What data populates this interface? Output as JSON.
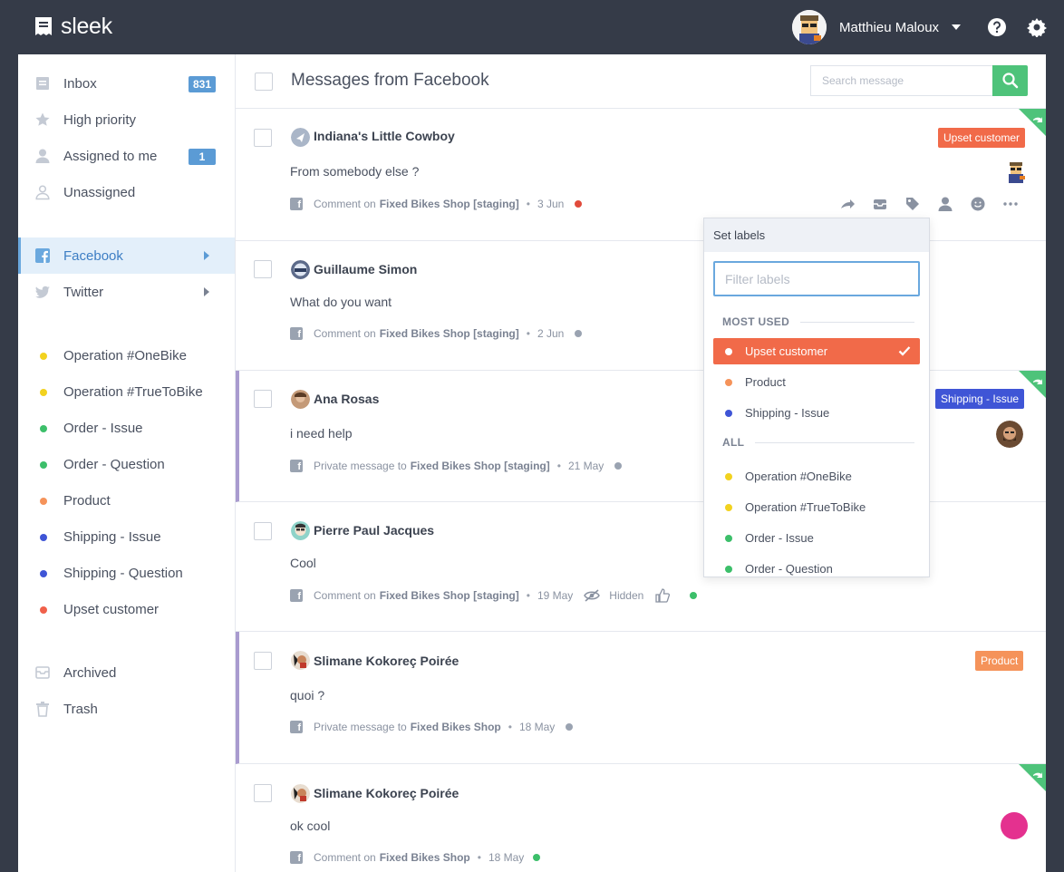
{
  "topbar": {
    "logo": "sleek",
    "user_name": "Matthieu Maloux"
  },
  "sidebar": {
    "items": [
      {
        "label": "Inbox",
        "badge": "831"
      },
      {
        "label": "High priority"
      },
      {
        "label": "Assigned to me",
        "badge": "1"
      },
      {
        "label": "Unassigned"
      },
      {
        "label": "Facebook"
      },
      {
        "label": "Twitter"
      },
      {
        "label": "Operation #OneBike",
        "color": "#f2d21f"
      },
      {
        "label": "Operation #TrueToBike",
        "color": "#f2d21f"
      },
      {
        "label": "Order - Issue",
        "color": "#3cbf6a"
      },
      {
        "label": "Order - Question",
        "color": "#3cbf6a"
      },
      {
        "label": "Product",
        "color": "#f5935a"
      },
      {
        "label": "Shipping - Issue",
        "color": "#3f55d6"
      },
      {
        "label": "Shipping - Question",
        "color": "#3f55d6"
      },
      {
        "label": "Upset customer",
        "color": "#f0604a"
      },
      {
        "label": "Archived"
      },
      {
        "label": "Trash"
      }
    ]
  },
  "header": {
    "title": "Messages from Facebook",
    "search_placeholder": "Search message"
  },
  "messages": [
    {
      "name": "Indiana's Little Cowboy",
      "text": "From somebody else ?",
      "meta_prefix": "Comment on",
      "page": "Fixed Bikes Shop [staging]",
      "date": "3 Jun",
      "status_color": "#e14b3b",
      "label": "Upset customer",
      "label_color": "#f16a49"
    },
    {
      "name": "Guillaume Simon",
      "text": "What do you want",
      "meta_prefix": "Comment on",
      "page": "Fixed Bikes Shop [staging]",
      "date": "2 Jun",
      "status_color": "#9aa3b1"
    },
    {
      "name": "Ana Rosas",
      "text": "i need help",
      "meta_prefix": "Private message to",
      "page": "Fixed Bikes Shop [staging]",
      "date": "21 May",
      "status_color": "#9aa3b1",
      "label": "Shipping - Issue",
      "label_color": "#3f55d6"
    },
    {
      "name": "Pierre Paul Jacques",
      "text": "Cool",
      "meta_prefix": "Comment on",
      "page": "Fixed Bikes Shop [staging]",
      "date": "19 May",
      "status_color": "#3cbf6a",
      "hidden_label": "Hidden"
    },
    {
      "name": "Slimane Kokoreç Poirée",
      "text": "quoi ?",
      "meta_prefix": "Private message to",
      "page": "Fixed Bikes Shop",
      "date": "18 May",
      "status_color": "#9aa3b1",
      "label": "Product",
      "label_color": "#f5935a"
    },
    {
      "name": "Slimane Kokoreç Poirée",
      "text": "ok cool",
      "meta_prefix": "Comment on",
      "page": "Fixed Bikes Shop",
      "date": "18 May",
      "status_color": "#3cbf6a"
    }
  ],
  "labels_popup": {
    "title": "Set labels",
    "filter_placeholder": "Filter labels",
    "section_most_used": "MOST USED",
    "section_all": "ALL",
    "most_used": [
      {
        "label": "Upset customer",
        "color": "#ffffff",
        "selected": true
      },
      {
        "label": "Product",
        "color": "#f5935a"
      },
      {
        "label": "Shipping - Issue",
        "color": "#3f55d6"
      }
    ],
    "all": [
      {
        "label": "Operation #OneBike",
        "color": "#f2d21f"
      },
      {
        "label": "Operation #TrueToBike",
        "color": "#f2d21f"
      },
      {
        "label": "Order - Issue",
        "color": "#3cbf6a"
      },
      {
        "label": "Order - Question",
        "color": "#3cbf6a"
      }
    ]
  },
  "colors": {
    "accent": "#5b9bd5",
    "search_button": "#4ec37a",
    "fab": "#e4318f"
  }
}
